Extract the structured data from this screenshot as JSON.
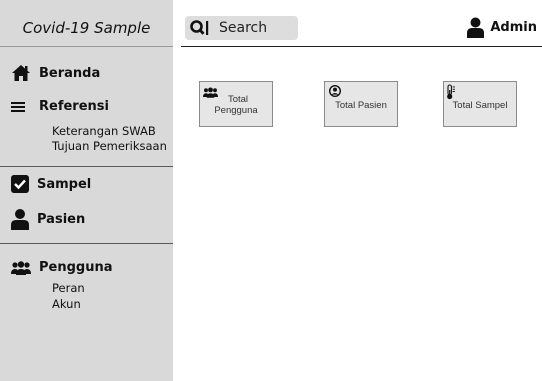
{
  "app": {
    "title": "Covid-19 Sample"
  },
  "search": {
    "placeholder": "Search"
  },
  "user": {
    "name": "Admin"
  },
  "sidebar": {
    "home": {
      "label": "Beranda",
      "icon": "home-icon"
    },
    "referensi": {
      "label": "Referensi",
      "icon": "menu-lines-icon",
      "items": [
        "Keterangan SWAB",
        "Tujuan Pemeriksaan"
      ]
    },
    "sampel": {
      "label": "Sampel",
      "icon": "checkbox-icon"
    },
    "pasien": {
      "label": "Pasien",
      "icon": "user-icon"
    },
    "pengguna": {
      "label": "Pengguna",
      "icon": "users-icon",
      "items": [
        "Peran",
        "Akun"
      ]
    }
  },
  "cards": [
    {
      "label_line1": "Total",
      "label_line2": "Pengguna",
      "icon": "users-icon"
    },
    {
      "label": "Total Pasien",
      "icon": "user-circle-icon"
    },
    {
      "label": "Total Sampel",
      "icon": "thermometer-icon"
    }
  ]
}
